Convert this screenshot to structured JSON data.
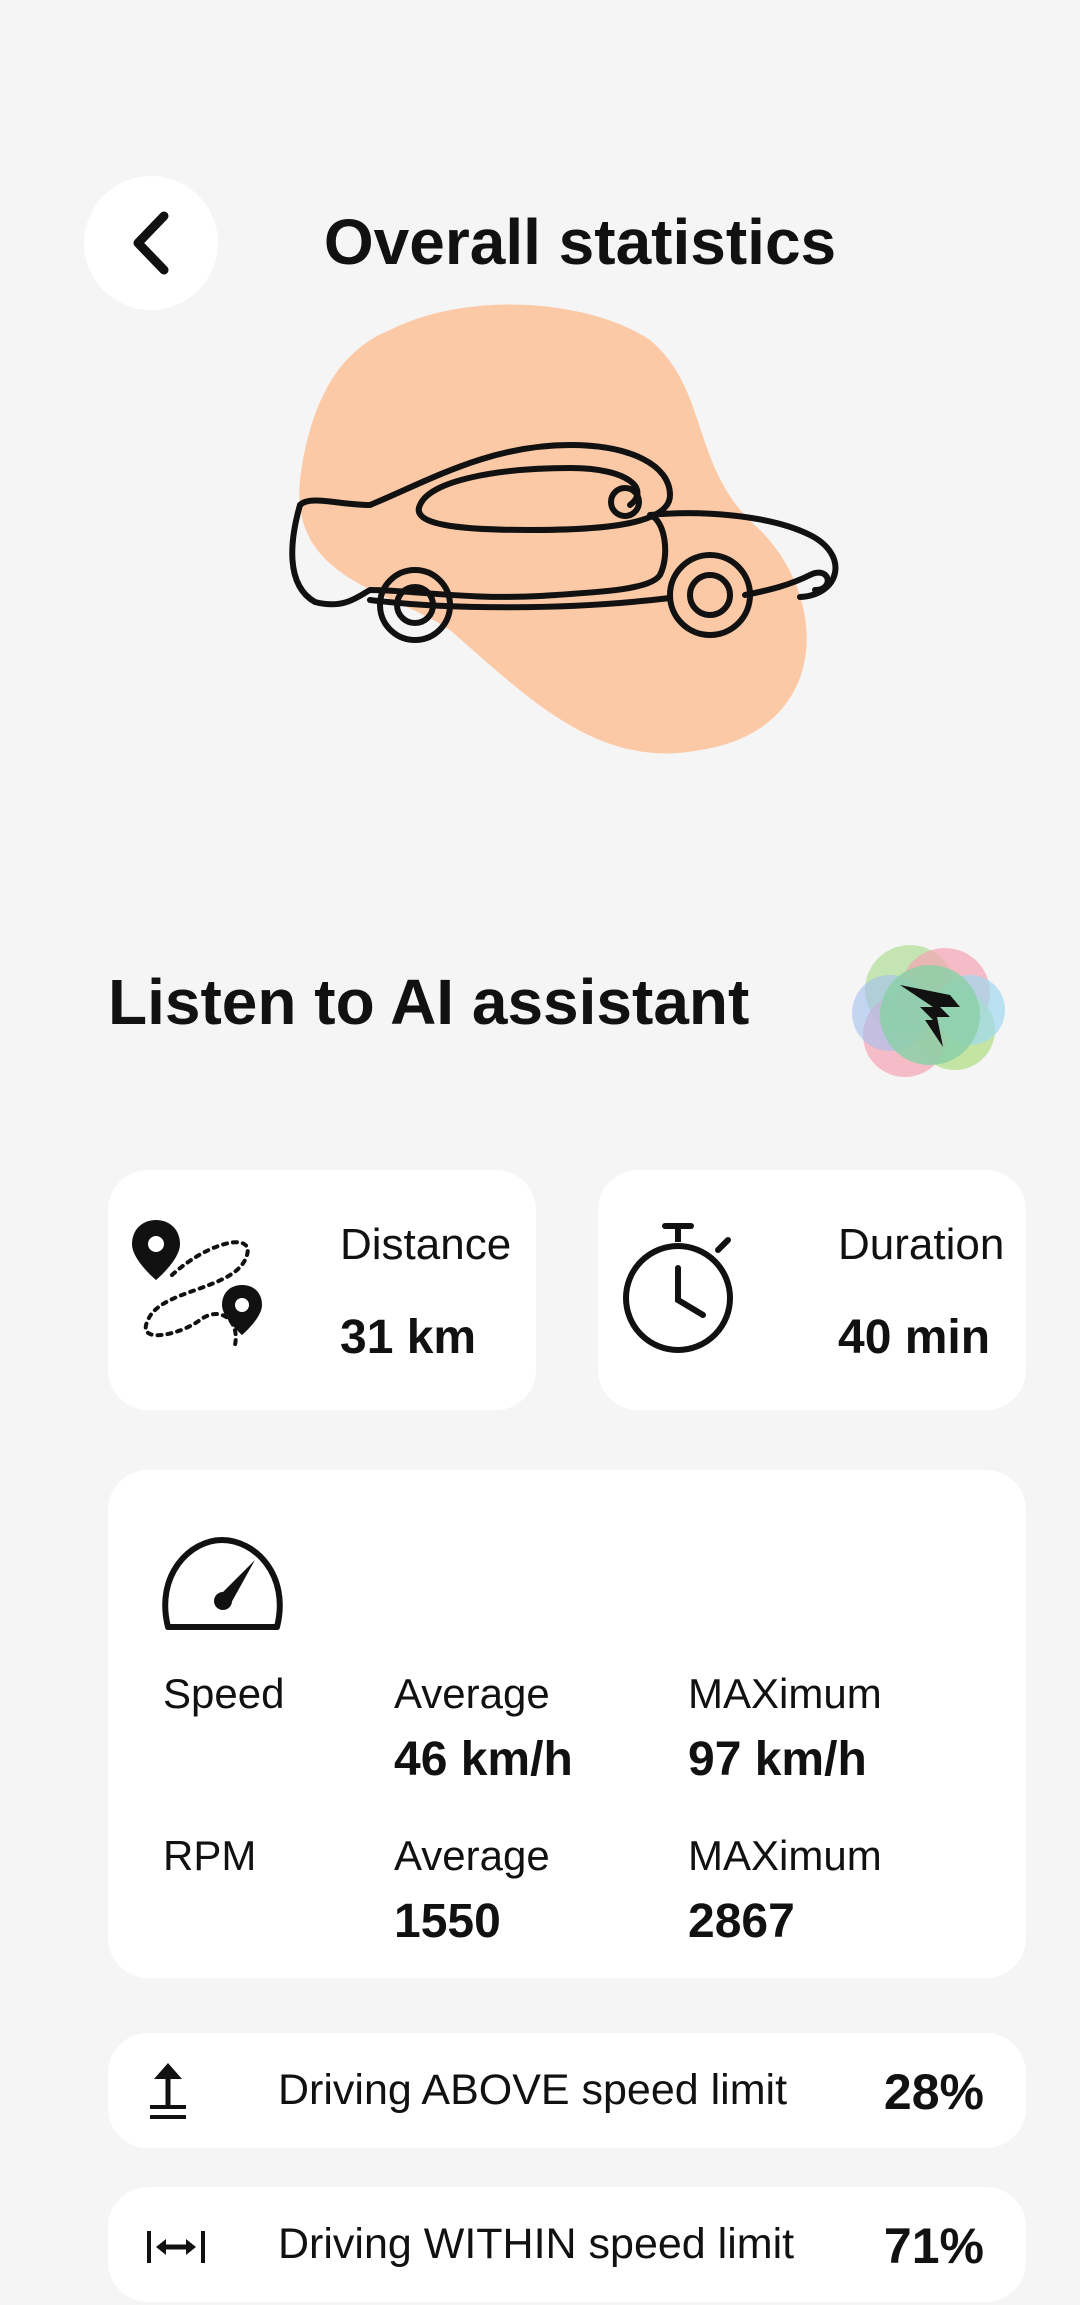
{
  "header": {
    "title": "Overall statistics",
    "back_icon": "chevron-left-icon"
  },
  "hero": {
    "illustration": "car-line-art",
    "blob_color": "#fcc9a6"
  },
  "ai": {
    "label": "Listen to AI assistant",
    "icon": "ai-assistant-orb-icon"
  },
  "distance": {
    "label": "Distance",
    "value": "31 km",
    "icon": "route-pins-icon"
  },
  "duration": {
    "label": "Duration",
    "value": "40 min",
    "icon": "stopwatch-icon"
  },
  "speed_card": {
    "icon": "speedometer-icon",
    "speed": {
      "label": "Speed",
      "avg_label": "Average",
      "avg_value": "46 km/h",
      "max_label": "MAXimum",
      "max_value": "97 km/h"
    },
    "rpm": {
      "label": "RPM",
      "avg_label": "Average",
      "avg_value": "1550",
      "max_label": "MAXimum",
      "max_value": "2867"
    }
  },
  "limits": [
    {
      "icon": "arrow-up-line-icon",
      "label": "Driving ABOVE speed limit",
      "value": "28%"
    },
    {
      "icon": "arrows-horizontal-icon",
      "label": "Driving WITHIN speed limit",
      "value": "71%"
    }
  ]
}
